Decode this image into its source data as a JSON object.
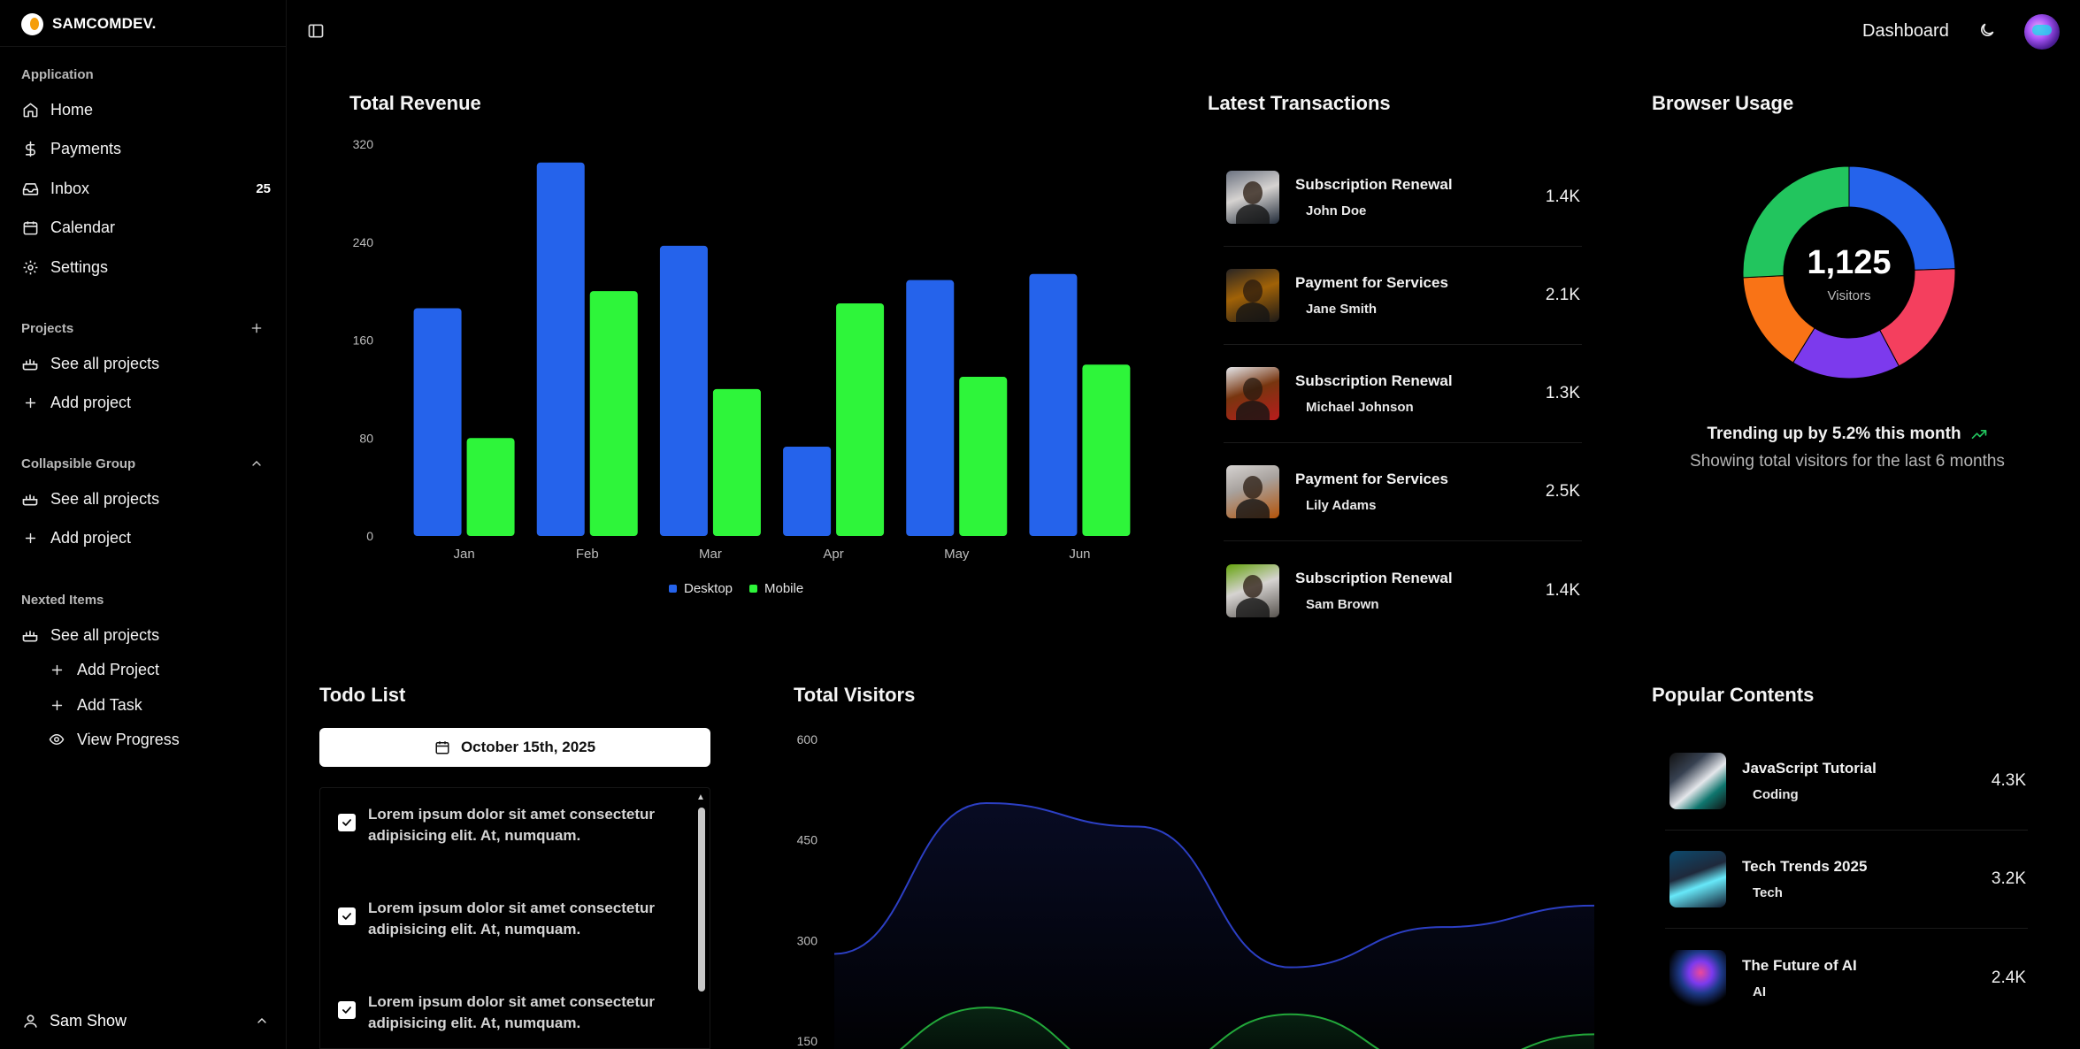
{
  "brand": {
    "name": "SAMCOMDEV."
  },
  "sidebar": {
    "application_label": "Application",
    "nav": [
      {
        "label": "Home",
        "icon": "home-icon"
      },
      {
        "label": "Payments",
        "icon": "dollar-icon"
      },
      {
        "label": "Inbox",
        "icon": "inbox-icon",
        "badge": "25"
      },
      {
        "label": "Calendar",
        "icon": "calendar-icon"
      },
      {
        "label": "Settings",
        "icon": "gear-icon"
      }
    ],
    "projects_label": "Projects",
    "projects": [
      {
        "label": "See all projects",
        "icon": "projects-icon"
      },
      {
        "label": "Add project",
        "icon": "plus-icon"
      }
    ],
    "collapsible_label": "Collapsible Group",
    "collapsible": [
      {
        "label": "See all projects",
        "icon": "projects-icon"
      },
      {
        "label": "Add project",
        "icon": "plus-icon"
      }
    ],
    "nested_label": "Nexted Items",
    "nested_parent": {
      "label": "See all projects",
      "icon": "projects-icon"
    },
    "nested_children": [
      {
        "label": "Add Project",
        "icon": "plus-icon"
      },
      {
        "label": "Add Task",
        "icon": "plus-icon"
      },
      {
        "label": "View Progress",
        "icon": "eye-icon"
      }
    ],
    "user": {
      "name": "Sam Show"
    }
  },
  "topbar": {
    "title": "Dashboard"
  },
  "revenue": {
    "title": "Total Revenue",
    "legend": [
      "Desktop",
      "Mobile"
    ]
  },
  "transactions": {
    "title": "Latest Transactions",
    "items": [
      {
        "title": "Subscription Renewal",
        "name": "John Doe",
        "amount": "1.4K"
      },
      {
        "title": "Payment for Services",
        "name": "Jane Smith",
        "amount": "2.1K"
      },
      {
        "title": "Subscription Renewal",
        "name": "Michael Johnson",
        "amount": "1.3K"
      },
      {
        "title": "Payment for Services",
        "name": "Lily Adams",
        "amount": "2.5K"
      },
      {
        "title": "Subscription Renewal",
        "name": "Sam Brown",
        "amount": "1.4K"
      }
    ]
  },
  "browser": {
    "title": "Browser Usage",
    "total": "1,125",
    "total_label": "Visitors",
    "trend_text": "Trending up by 5.2% this month",
    "sub_text": "Showing total visitors for the last 6 months"
  },
  "todo": {
    "title": "Todo List",
    "date": "October 15th, 2025",
    "items": [
      {
        "text": "Lorem ipsum dolor sit amet consectetur adipisicing elit. At, numquam.",
        "checked": true
      },
      {
        "text": "Lorem ipsum dolor sit amet consectetur adipisicing elit. At, numquam.",
        "checked": true
      },
      {
        "text": "Lorem ipsum dolor sit amet consectetur adipisicing elit. At, numquam.",
        "checked": true
      }
    ]
  },
  "visitors": {
    "title": "Total Visitors"
  },
  "popular": {
    "title": "Popular Contents",
    "items": [
      {
        "title": "JavaScript Tutorial",
        "tag": "Coding",
        "amount": "4.3K"
      },
      {
        "title": "Tech Trends 2025",
        "tag": "Tech",
        "amount": "3.2K"
      },
      {
        "title": "The Future of AI",
        "tag": "AI",
        "amount": "2.4K"
      }
    ]
  },
  "colors": {
    "desktop": "#2563eb",
    "mobile": "#2ef53a",
    "donut": [
      "#2563eb",
      "#f43f5e",
      "#7c3aed",
      "#f97316",
      "#22c55e"
    ]
  },
  "chart_data": [
    {
      "type": "bar",
      "title": "Total Revenue",
      "categories": [
        "Jan",
        "Feb",
        "Mar",
        "Apr",
        "May",
        "Jun"
      ],
      "series": [
        {
          "name": "Desktop",
          "values": [
            186,
            305,
            237,
            73,
            209,
            214
          ]
        },
        {
          "name": "Mobile",
          "values": [
            80,
            200,
            120,
            190,
            130,
            140
          ]
        }
      ],
      "ylim": [
        0,
        320
      ],
      "yticks": [
        0,
        80,
        160,
        240,
        320
      ],
      "legend": "bottom",
      "grid": false
    },
    {
      "type": "pie",
      "title": "Browser Usage",
      "values": [
        275,
        200,
        187,
        173,
        290
      ],
      "center_text": "1,125",
      "center_label": "Visitors"
    },
    {
      "type": "area",
      "title": "Total Visitors",
      "yticks": [
        150,
        300,
        450,
        600
      ],
      "visible_range": [
        140,
        600
      ],
      "series": [
        {
          "values": [
            280,
            505,
            470,
            260,
            320,
            352
          ],
          "color": "#2c3fc4"
        },
        {
          "values": [
            100,
            200,
            95,
            190,
            110,
            160
          ],
          "color": "#22a83a"
        }
      ]
    }
  ]
}
